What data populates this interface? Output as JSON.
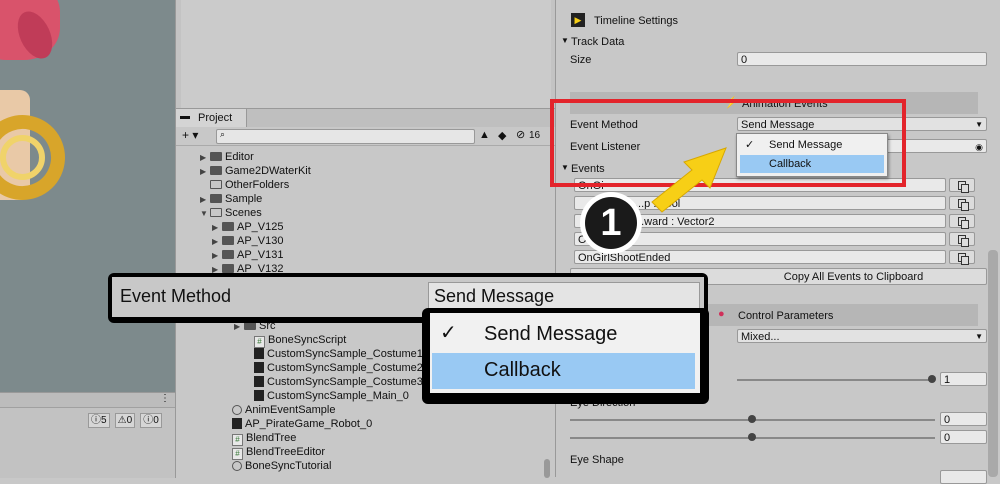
{
  "colors": {
    "highlight": "#99c9f3",
    "red_box": "#e3242b",
    "arrow": "#f7cf16"
  },
  "console": {
    "warn_count": "5",
    "error_count": "0",
    "info_count": "0",
    "menu": "⋮"
  },
  "project": {
    "tab_label": "Project",
    "add_label": "+ ▾",
    "count": "16",
    "tree": [
      {
        "label": "Editor",
        "kind": "folder",
        "arrow": "▶"
      },
      {
        "label": "Game2DWaterKit",
        "kind": "folder",
        "arrow": "▶"
      },
      {
        "label": "OtherFolders",
        "kind": "folder-open",
        "arrow": ""
      },
      {
        "label": "Sample",
        "kind": "folder",
        "arrow": "▶"
      },
      {
        "label": "Scenes",
        "kind": "folder-open",
        "arrow": "▼"
      },
      {
        "label": "AP_V125",
        "kind": "folder",
        "arrow": "▶"
      },
      {
        "label": "AP_V130",
        "kind": "folder",
        "arrow": "▶"
      },
      {
        "label": "AP_V131",
        "kind": "folder",
        "arrow": "▶"
      },
      {
        "label": "AP_V132",
        "kind": "folder",
        "arrow": "▶"
      },
      {
        "label": "Src",
        "kind": "folder",
        "arrow": "▶"
      },
      {
        "label": "BoneSyncScript",
        "kind": "script",
        "arrow": ""
      },
      {
        "label": "CustomSyncSample_Costume1_0",
        "kind": "thumb",
        "arrow": ""
      },
      {
        "label": "CustomSyncSample_Costume2_0",
        "kind": "thumb",
        "arrow": ""
      },
      {
        "label": "CustomSyncSample_Costume3_0",
        "kind": "thumb",
        "arrow": ""
      },
      {
        "label": "CustomSyncSample_Main_0",
        "kind": "thumb",
        "arrow": ""
      },
      {
        "label": "AnimEventSample",
        "kind": "anim",
        "arrow": ""
      },
      {
        "label": "AP_PirateGame_Robot_0",
        "kind": "thumb",
        "arrow": ""
      },
      {
        "label": "BlendTree",
        "kind": "script",
        "arrow": ""
      },
      {
        "label": "BlendTreeEditor",
        "kind": "script",
        "arrow": ""
      },
      {
        "label": "BoneSyncTutorial",
        "kind": "anim",
        "arrow": ""
      }
    ]
  },
  "inspector": {
    "timeline_settings": "Timeline Settings",
    "track_data": "Track Data",
    "size_label": "Size",
    "size_value": "0",
    "animation_events": "Animation Events",
    "event_method_label": "Event Method",
    "event_method_value": "Send Message",
    "event_listener_label": "Event Listener",
    "events_label": "Events",
    "events": [
      "OnGi",
      "...p : bool",
      "...ward : Vector2",
      "O",
      "OnGirlShootEnded"
    ],
    "copy_all": "Copy All Events to Clipboard",
    "control_parameters": "Control Parameters",
    "mixed": "Mixed...",
    "slider1_value": "1",
    "eye_direction": "Eye Direction",
    "slider2_value": "0",
    "slider3_value": "0",
    "eye_shape": "Eye Shape"
  },
  "dropdown": {
    "options": [
      "Send Message",
      "Callback"
    ],
    "selected": "Send Message",
    "hovered": "Callback",
    "check": "✓"
  },
  "zoom": {
    "label": "Event Method",
    "value": "Send Message",
    "options": [
      "Send Message",
      "Callback"
    ]
  },
  "badge": {
    "number": "1"
  }
}
